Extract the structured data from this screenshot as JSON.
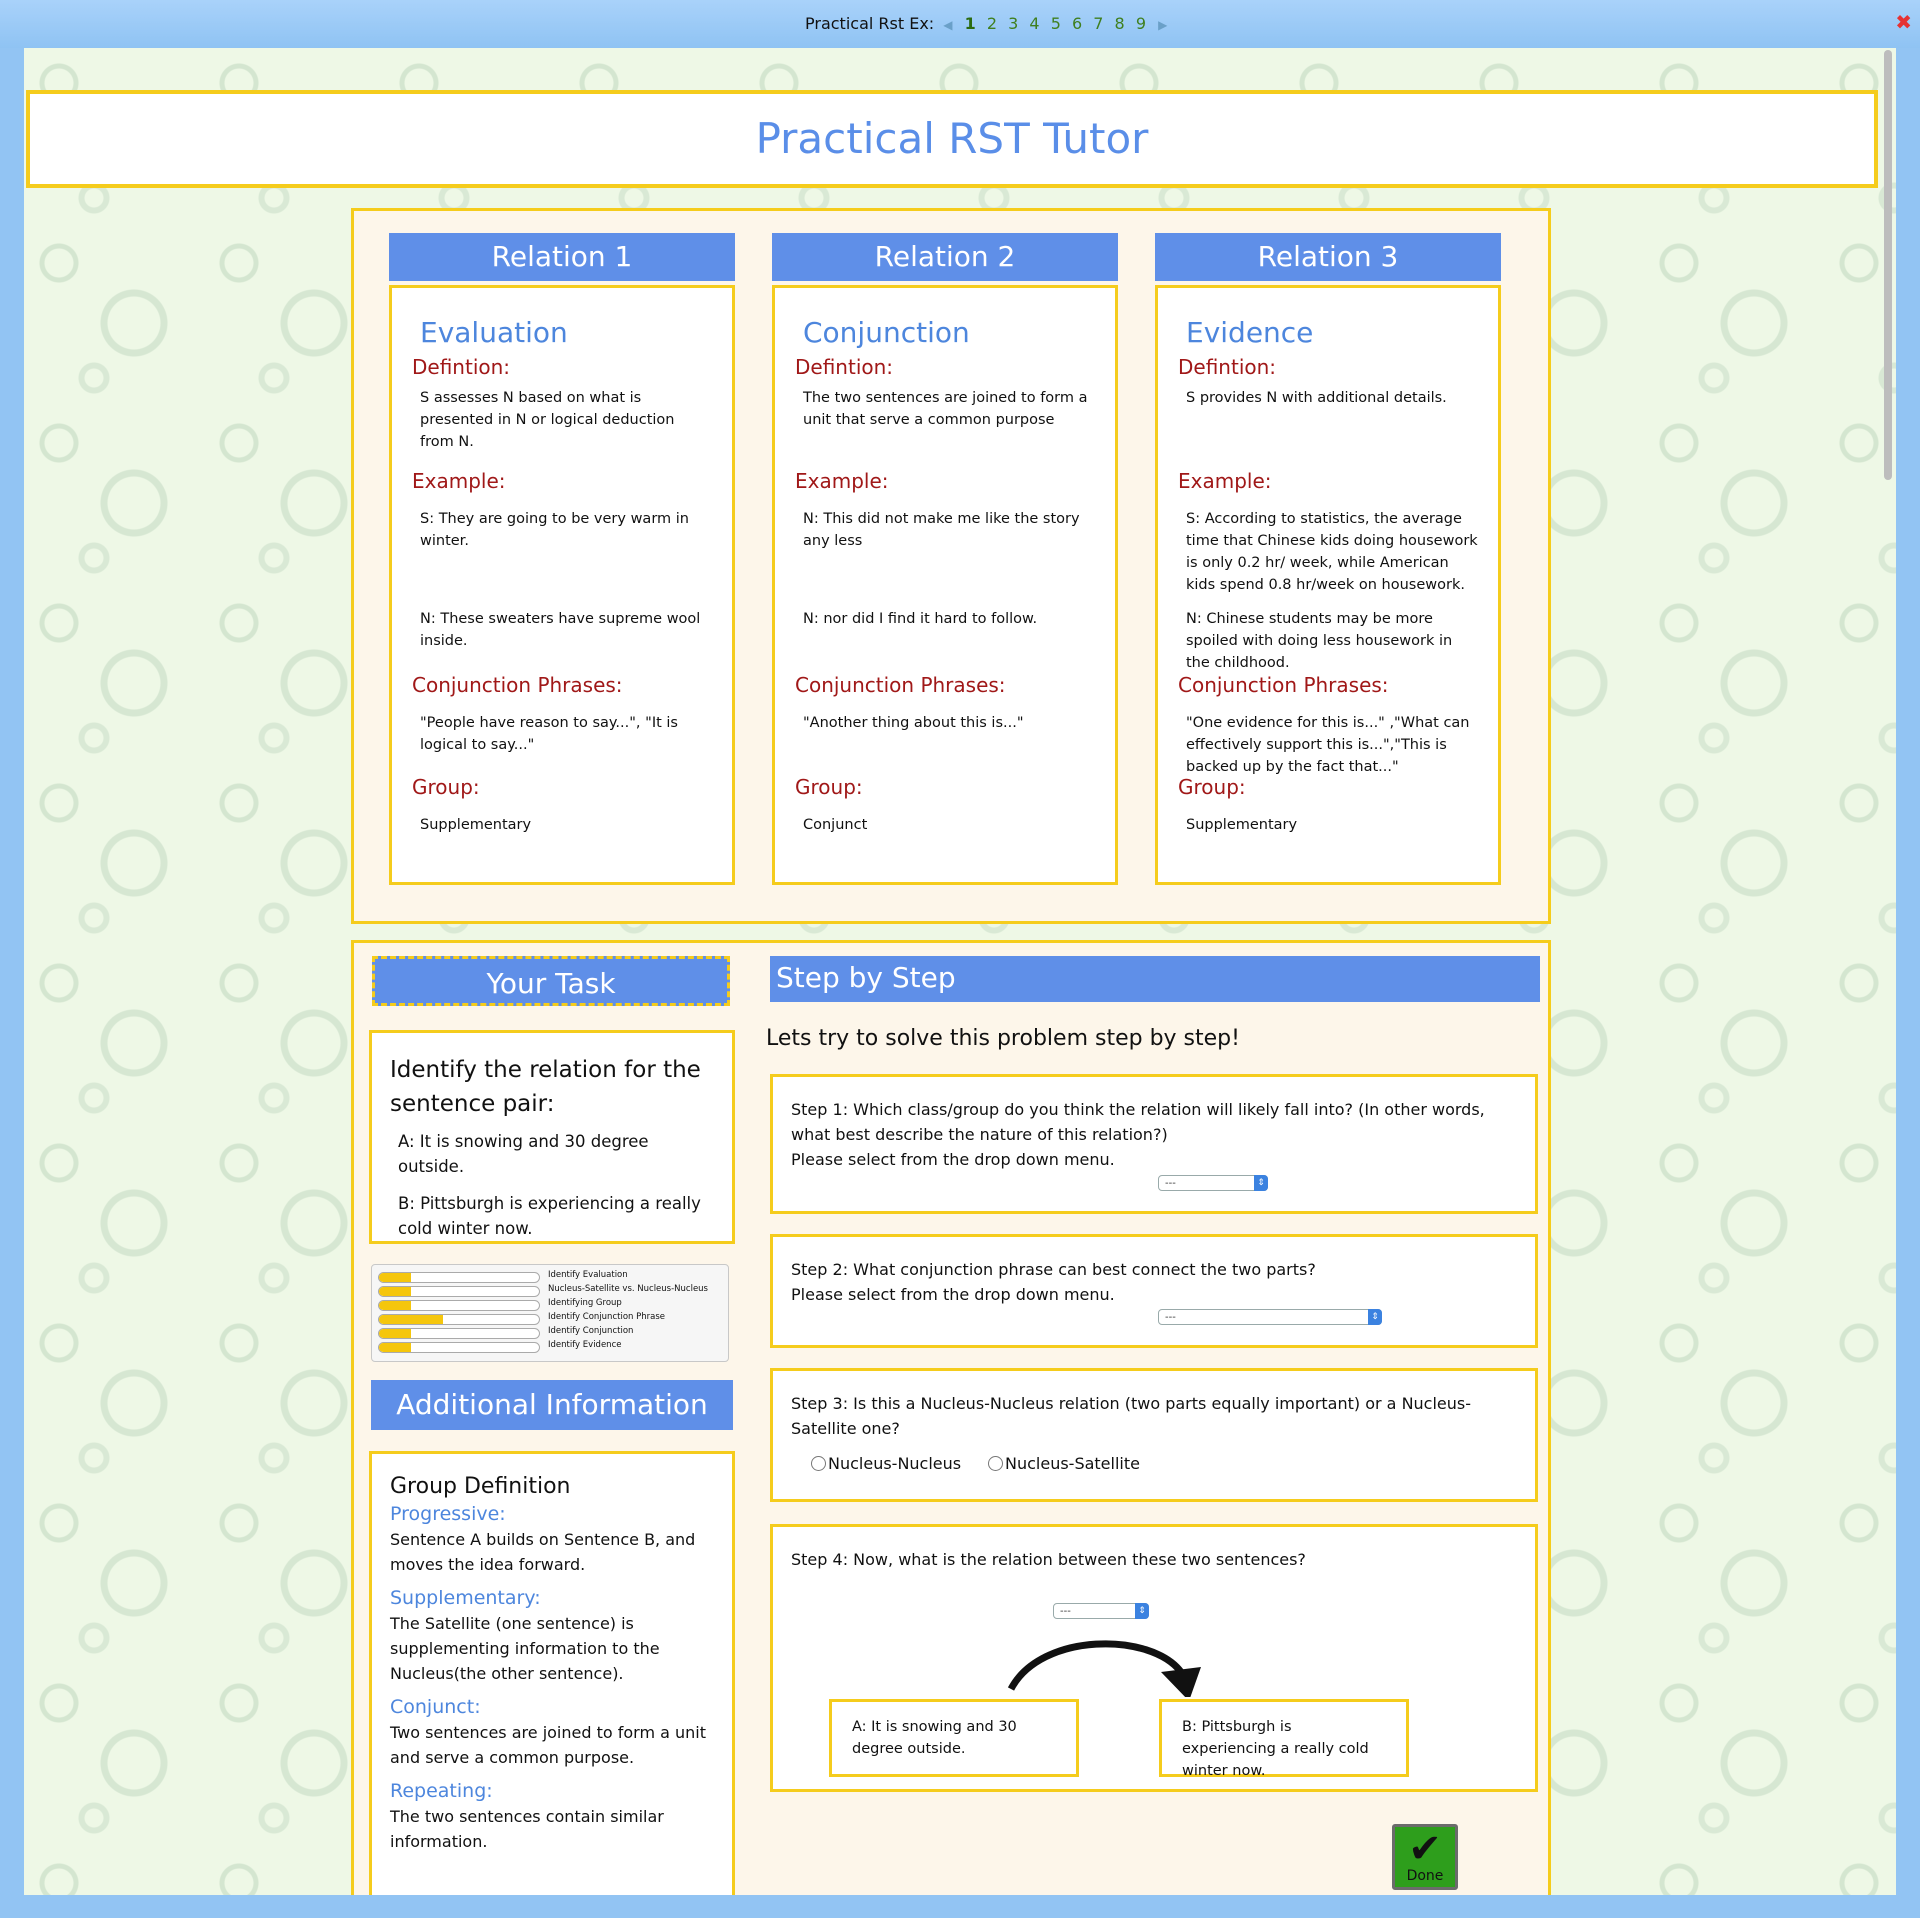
{
  "nav": {
    "label": "Practical Rst Ex:",
    "pages": [
      "1",
      "2",
      "3",
      "4",
      "5",
      "6",
      "7",
      "8",
      "9"
    ],
    "prev_icon": "prev-arrow-icon",
    "next_icon": "next-arrow-icon",
    "close_icon": "close-icon"
  },
  "title": "Practical RST Tutor",
  "relations": [
    {
      "header": "Relation 1",
      "name": "Evaluation",
      "definition_label": "Defintion:",
      "definition": "S assesses N based on what is presented in N or logical deduction from N.",
      "example_label": "Example:",
      "example_s": "S: They are going to be very warm in winter.",
      "example_n": "N: These sweaters have supreme wool inside.",
      "phrases_label": "Conjunction Phrases:",
      "phrases": "\"People have reason to say...\", \"It is logical to say...\"",
      "group_label": "Group:",
      "group": "Supplementary"
    },
    {
      "header": "Relation 2",
      "name": "Conjunction",
      "definition_label": "Defintion:",
      "definition": "The two sentences are joined to form a unit that serve a common purpose",
      "example_label": "Example:",
      "example_s": "N: This did not make me like the story any less",
      "example_n": "N: nor did I find it hard to follow.",
      "phrases_label": "Conjunction Phrases:",
      "phrases": "\"Another thing about this is...\"",
      "group_label": "Group:",
      "group": "Conjunct"
    },
    {
      "header": "Relation 3",
      "name": "Evidence",
      "definition_label": "Defintion:",
      "definition": "S provides N with additional details.",
      "example_label": "Example:",
      "example_s": "S: According to statistics, the average time that Chinese kids doing housework is only 0.2 hr/ week, while American kids spend 0.8 hr/week on housework.",
      "example_n": "N: Chinese students may be more spoiled with doing less housework in the childhood.",
      "phrases_label": "Conjunction Phrases:",
      "phrases": "\"One evidence for this is...\" ,\"What can effectively support this is...\",\"This is backed up by the fact that...\"",
      "group_label": "Group:",
      "group": "Supplementary"
    }
  ],
  "task": {
    "header": "Your Task",
    "question": "Identify the relation for the sentence pair:",
    "sentence_a": "A: It is snowing and 30 degree outside.",
    "sentence_b": "B: Pittsburgh is experiencing a really cold winter now."
  },
  "skills": [
    {
      "name": "Identify Evaluation",
      "progress": 0.2
    },
    {
      "name": "Nucleus-Satellite vs. Nucleus-Nucleus",
      "progress": 0.2
    },
    {
      "name": "Identifying Group",
      "progress": 0.2
    },
    {
      "name": "Identify Conjunction Phrase",
      "progress": 0.4
    },
    {
      "name": "Identify Conjunction",
      "progress": 0.2
    },
    {
      "name": "Identify Evidence",
      "progress": 0.2
    }
  ],
  "additional": {
    "header": "Additional Information",
    "group_title": "Group Definition",
    "groups": [
      {
        "name": "Progressive:",
        "text": "Sentence A builds on Sentence B, and moves the idea forward."
      },
      {
        "name": "Supplementary:",
        "text": "The Satellite (one sentence) is supplementing information to the Nucleus(the other sentence)."
      },
      {
        "name": "Conjunct:",
        "text": "Two sentences are joined to form a unit and serve a common purpose."
      },
      {
        "name": "Repeating:",
        "text": "The two sentences contain similar information."
      }
    ]
  },
  "steps": {
    "header": "Step by Step",
    "intro": "Lets try to solve this problem step by step!",
    "step1": "Step 1: Which class/group do you think the relation will likely fall into? (In other words, what best describe the nature of this relation?)",
    "step1_hint": "Please select from the drop down menu.",
    "step1_select": "---",
    "step2": "Step 2: What conjunction phrase can best connect the two parts?",
    "step2_hint": "Please select from the drop down menu.",
    "step2_select": "---",
    "step3": "Step 3: Is this a Nucleus-Nucleus relation (two parts equally important) or a Nucleus-Satellite one?",
    "radio1": "Nucleus-Nucleus",
    "radio2": "Nucleus-Satellite",
    "step4": "Step 4: Now, what is the relation between these two sentences?",
    "step4_select": "---",
    "box_a": "A: It is snowing and 30 degree outside.",
    "box_b": "B: Pittsburgh is experiencing a really cold winter now.",
    "dropdown_icon": "dropdown-arrow-icon",
    "curve_icon": "curved-arrow-icon"
  },
  "done": {
    "label": "Done",
    "icon": "checkmark-icon"
  },
  "colors": {
    "accent": "#5f8fe8",
    "border": "#f5cc1c",
    "label_red": "#a01818",
    "title_blue": "#5a8ee8"
  }
}
